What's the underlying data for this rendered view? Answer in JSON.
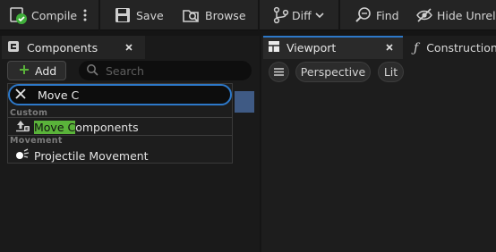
{
  "toolbar": {
    "compile_label": "Compile",
    "save_label": "Save",
    "browse_label": "Browse",
    "diff_label": "Diff",
    "find_label": "Find",
    "hide_label": "Hide Unrela"
  },
  "components_panel": {
    "tab_label": "Components",
    "add_label": "Add",
    "search_placeholder": "Search",
    "picker": {
      "search_value": "Move C",
      "categories": [
        {
          "name": "Custom",
          "items": [
            {
              "match": "Move C",
              "rest": "omponents",
              "icon": "custom-component-icon"
            }
          ]
        },
        {
          "name": "Movement",
          "items": [
            {
              "match": "",
              "rest": "Projectile Movement",
              "icon": "projectile-movement-icon"
            }
          ]
        }
      ]
    }
  },
  "viewport": {
    "tab_label": "Viewport",
    "construction_tab_label": "Construction",
    "perspective_label": "Perspective",
    "lit_label": "Lit"
  },
  "colors": {
    "accent_blue": "#2d78c8",
    "match_green": "#5ab33a",
    "selection": "#3f5a84"
  }
}
